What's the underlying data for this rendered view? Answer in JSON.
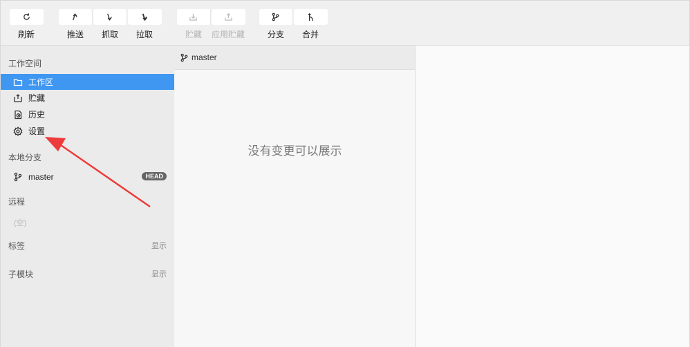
{
  "toolbar": {
    "refresh": "刷新",
    "push": "推送",
    "fetch": "抓取",
    "pull": "拉取",
    "stash": "贮藏",
    "apply_stash": "应用贮藏",
    "branch": "分支",
    "merge": "合并"
  },
  "sidebar": {
    "workspace_title": "工作空间",
    "items": [
      {
        "label": "工作区",
        "icon": "folder-icon"
      },
      {
        "label": "贮藏",
        "icon": "stash-icon"
      },
      {
        "label": "历史",
        "icon": "history-icon"
      },
      {
        "label": "设置",
        "icon": "gear-icon"
      }
    ],
    "local_branches_title": "本地分支",
    "branch": {
      "name": "master",
      "badge": "HEAD"
    },
    "remote_title": "远程",
    "remote_empty": "(空)",
    "tags_title": "标签",
    "tags_show": "显示",
    "submodules_title": "子模块",
    "submodules_show": "显示"
  },
  "main": {
    "branch_label": "master",
    "empty_message": "没有变更可以展示"
  },
  "colors": {
    "accent": "#3f97f2",
    "annotation_arrow": "#ee3b3b"
  }
}
